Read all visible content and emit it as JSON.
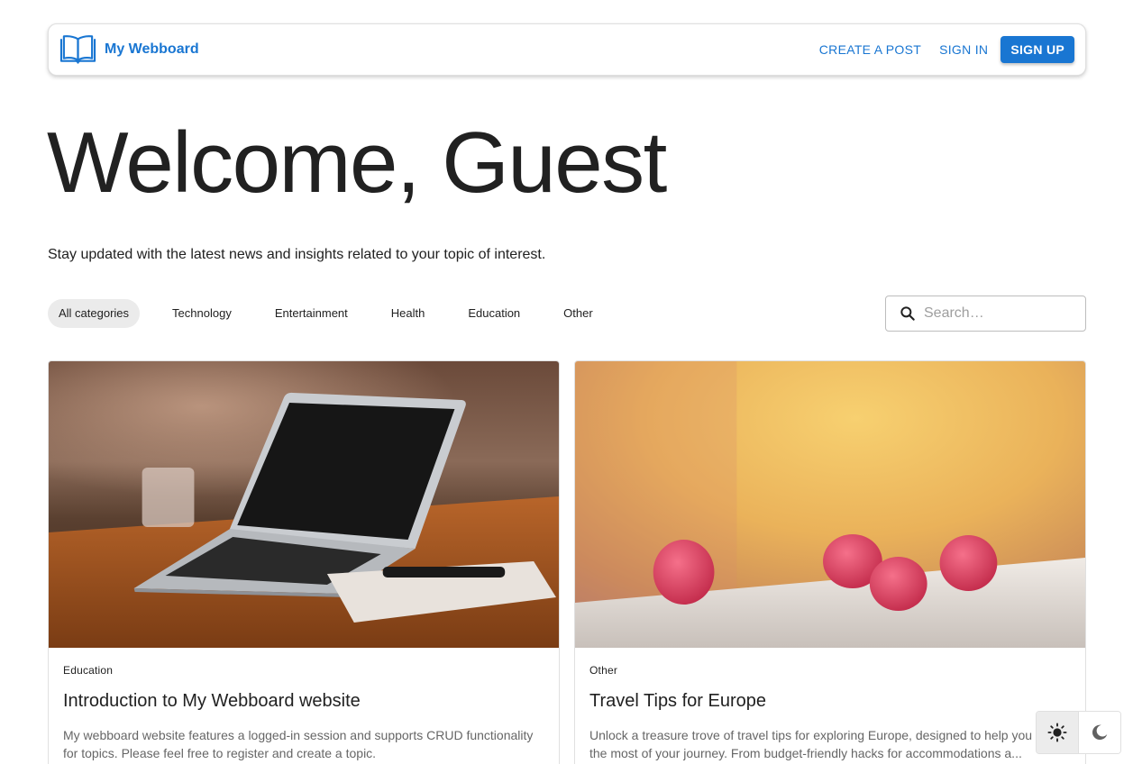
{
  "navbar": {
    "brand_name": "My Webboard",
    "create_post": "CREATE A POST",
    "sign_in": "SIGN IN",
    "sign_up": "SIGN UP",
    "accent_color": "#1976d2"
  },
  "hero": {
    "title": "Welcome, Guest",
    "subtitle": "Stay updated with the latest news and insights related to your topic of interest."
  },
  "categories": {
    "items": [
      "All categories",
      "Technology",
      "Entertainment",
      "Health",
      "Education",
      "Other"
    ],
    "active": "All categories"
  },
  "search": {
    "placeholder": "Search…",
    "value": "",
    "icon": "search-icon"
  },
  "posts": [
    {
      "category": "Education",
      "title": "Introduction to My Webboard website",
      "description": "My webboard website features a logged-in session and supports CRUD functionality for topics. Please feel free to register and create a topic.",
      "image": "laptop-on-wooden-table-photo"
    },
    {
      "category": "Other",
      "title": "Travel Tips for Europe",
      "description": "Unlock a treasure trove of travel tips for exploring Europe, designed to help you make the most of your journey. From budget-friendly hacks for accommodations a...",
      "image": "raspberries-on-ledge-photo"
    }
  ],
  "theme": {
    "options": [
      "light-mode-icon",
      "dark-mode-icon"
    ],
    "active": "light-mode-icon"
  }
}
